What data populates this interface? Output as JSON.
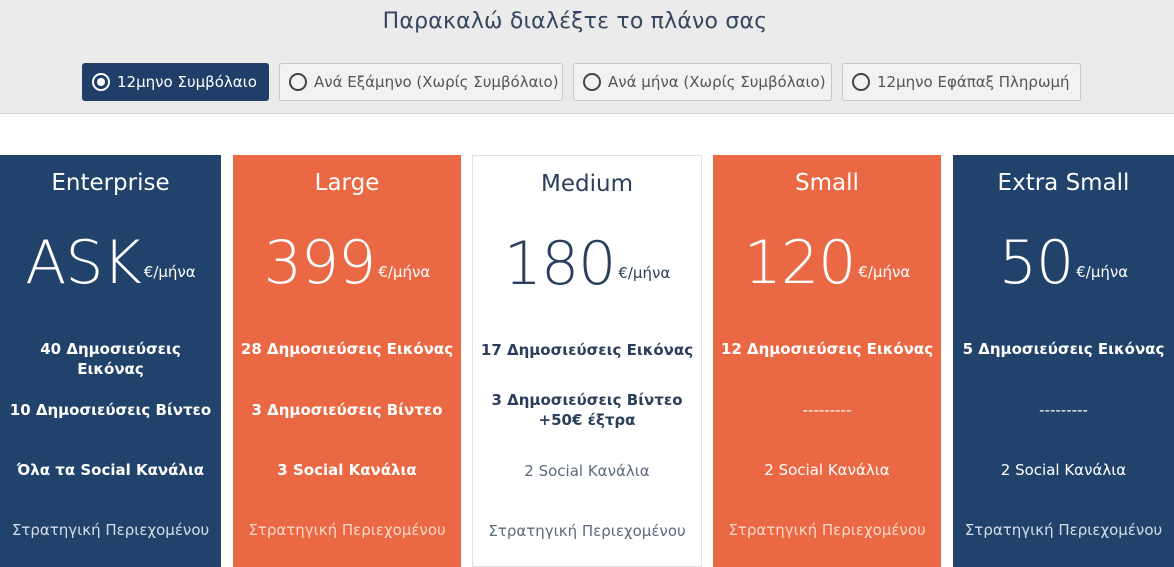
{
  "header": {
    "title": "Παρακαλώ διαλέξτε το πλάνο σας",
    "options": [
      {
        "label": "12μηνο Συμβόλαιο",
        "selected": true
      },
      {
        "label": "Ανά Εξάμηνο (Χωρίς Συμβόλαιο)",
        "selected": false
      },
      {
        "label": "Ανά μήνα (Χωρίς Συμβόλαιο)",
        "selected": false
      },
      {
        "label": "12μηνο Εφάπαξ Πληρωμή",
        "selected": false
      }
    ]
  },
  "plans": [
    {
      "name": "Enterprise",
      "price": "ASK",
      "unit": "€/μήνα",
      "theme": "navy",
      "features": [
        "40 Δημοσιεύσεις Εικόνας",
        "10 Δημοσιεύσεις Βίντεο",
        "Όλα τα Social Κανάλια",
        "Στρατηγική Περιεχομένου"
      ]
    },
    {
      "name": "Large",
      "price": "399",
      "unit": "€/μήνα",
      "theme": "orange",
      "features": [
        "28 Δημοσιεύσεις Εικόνας",
        "3 Δημοσιεύσεις Βίντεο",
        "3 Social Κανάλια",
        "Στρατηγική Περιεχομένου"
      ]
    },
    {
      "name": "Medium",
      "price": "180",
      "unit": "€/μήνα",
      "theme": "white",
      "features": [
        "17 Δημοσιεύσεις Εικόνας",
        "3 Δημοσιεύσεις Βίντεο",
        "+50€ έξτρα",
        "2 Social Κανάλια",
        "Στρατηγική Περιεχομένου"
      ]
    },
    {
      "name": "Small",
      "price": "120",
      "unit": "€/μήνα",
      "theme": "orange",
      "features": [
        "12 Δημοσιεύσεις Εικόνας",
        "---------",
        "2 Social Κανάλια",
        "Στρατηγική Περιεχομένου"
      ]
    },
    {
      "name": "Extra Small",
      "price": "50",
      "unit": "€/μήνα",
      "theme": "navy",
      "features": [
        "5 Δημοσιεύσεις Εικόνας",
        "---------",
        "2 Social Κανάλια",
        "Στρατηγική Περιεχομένου"
      ]
    }
  ],
  "colors": {
    "navy": "#21426b",
    "orange": "#ea6944",
    "white": "#ffffff",
    "selected_button": "#1f3e68"
  }
}
